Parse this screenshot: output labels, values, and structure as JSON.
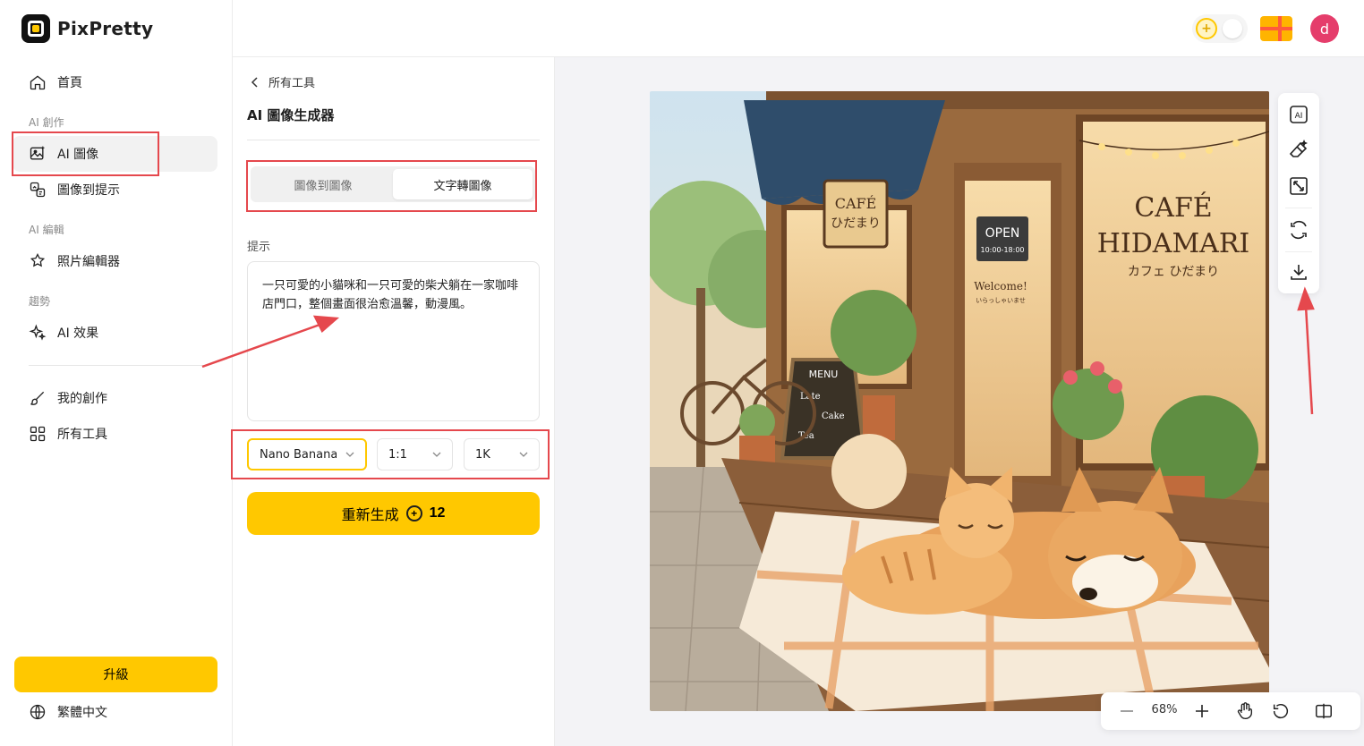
{
  "app": {
    "name": "PixPretty"
  },
  "sidebar": {
    "home": "首頁",
    "section_create": "AI 創作",
    "ai_image": "AI 圖像",
    "image_to_prompt": "圖像到提示",
    "section_edit": "AI 編輯",
    "photo_editor": "照片編輯器",
    "section_trend": "趨勢",
    "ai_effects": "AI 效果",
    "my_creations": "我的創作",
    "all_tools": "所有工具",
    "upgrade": "升級",
    "language": "繁體中文"
  },
  "topbar": {
    "avatar_letter": "d"
  },
  "panel": {
    "back_label": "所有工具",
    "title": "AI 圖像生成器",
    "tabs": [
      "圖像到圖像",
      "文字轉圖像"
    ],
    "active_tab": "文字轉圖像",
    "prompt_label": "提示",
    "prompt_text": "一只可愛的小貓咪和一只可愛的柴犬躺在一家咖啡店門口，整個畫面很治愈溫馨，動漫風。",
    "model": "Nano Banana",
    "ratio": "1:1",
    "resolution": "1K",
    "generate_label": "重新生成",
    "generate_cost": "12"
  },
  "image": {
    "sign_small": "CAFÉ ひだまり",
    "sign_small_line1": "CAFÉ",
    "sign_small_line2": "ひだまり",
    "open_sign": "OPEN",
    "open_hours": "10:00-18:00",
    "welcome": "Welcome!",
    "welcome_jp": "いらっしゃいませ",
    "window_line1": "CAFÉ",
    "window_line2": "HIDAMARI",
    "window_line3": "カフェ ひだまり",
    "menu_title": "MENU",
    "menu_items": [
      "Late",
      "Cake",
      "Tea"
    ]
  },
  "canvas": {
    "zoom": "68%"
  },
  "colors": {
    "accent": "#ffc800",
    "annotation": "#e5484d",
    "avatar": "#e53d6b"
  }
}
